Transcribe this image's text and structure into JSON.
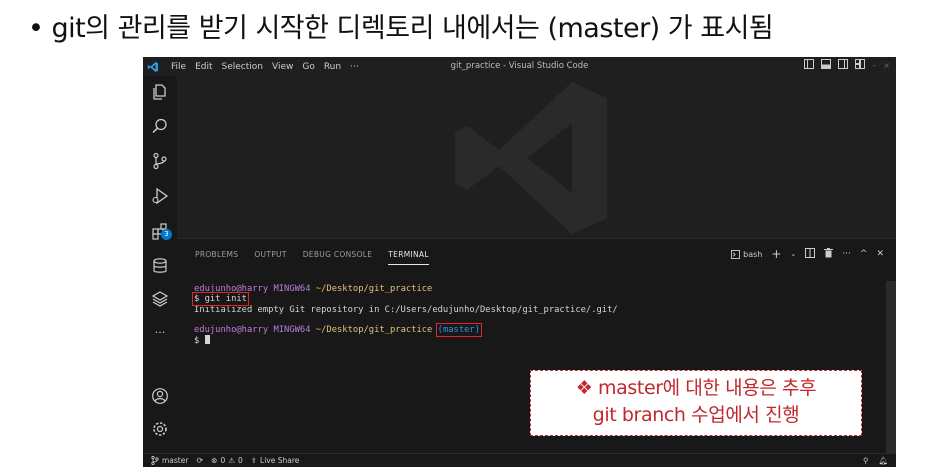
{
  "heading": {
    "bullet": "•",
    "text": "git의 관리를 받기 시작한 디렉토리 내에서는 (master) 가 표시됨"
  },
  "titlebar": {
    "menu": [
      "File",
      "Edit",
      "Selection",
      "View",
      "Go",
      "Run",
      "···"
    ],
    "title": "git_practice - Visual Studio Code"
  },
  "activitybar": {
    "icons": [
      "explorer-icon",
      "search-icon",
      "source-control-icon",
      "run-debug-icon",
      "extensions-icon",
      "database-icon",
      "layers-icon",
      "more-icon",
      "account-icon",
      "settings-gear-icon"
    ],
    "extensions_badge": "3",
    "more_label": "···"
  },
  "panel": {
    "tabs": [
      "PROBLEMS",
      "OUTPUT",
      "DEBUG CONSOLE",
      "TERMINAL"
    ],
    "active_tab": "TERMINAL",
    "shell_label": "bash"
  },
  "terminal": {
    "prompt1": {
      "user": "edujunho@harry",
      "host": "MINGW64",
      "path": "~/Desktop/git_practice"
    },
    "command": "$ git init",
    "output": "Initialized empty Git repository in C:/Users/edujunho/Desktop/git_practice/.git/",
    "prompt2": {
      "user": "edujunho@harry",
      "host": "MINGW64",
      "path": "~/Desktop/git_practice",
      "branch": "(master)"
    },
    "prompt_symbol": "$"
  },
  "note": {
    "line1": "❖ master에 대한 내용은 추후",
    "line2": "git branch 수업에서 진행"
  },
  "statusbar": {
    "branch": "master",
    "errors": "0",
    "warnings": "0",
    "live_share": "Live Share"
  },
  "colors": {
    "editor_bg": "#1f1f1f",
    "panel_bg": "#181818",
    "accent_blue": "#0078d4",
    "annotation_red": "#c0282d",
    "prompt_user": "#c678dd",
    "prompt_path": "#e5c07b",
    "branch_blue": "#3b8eea"
  }
}
